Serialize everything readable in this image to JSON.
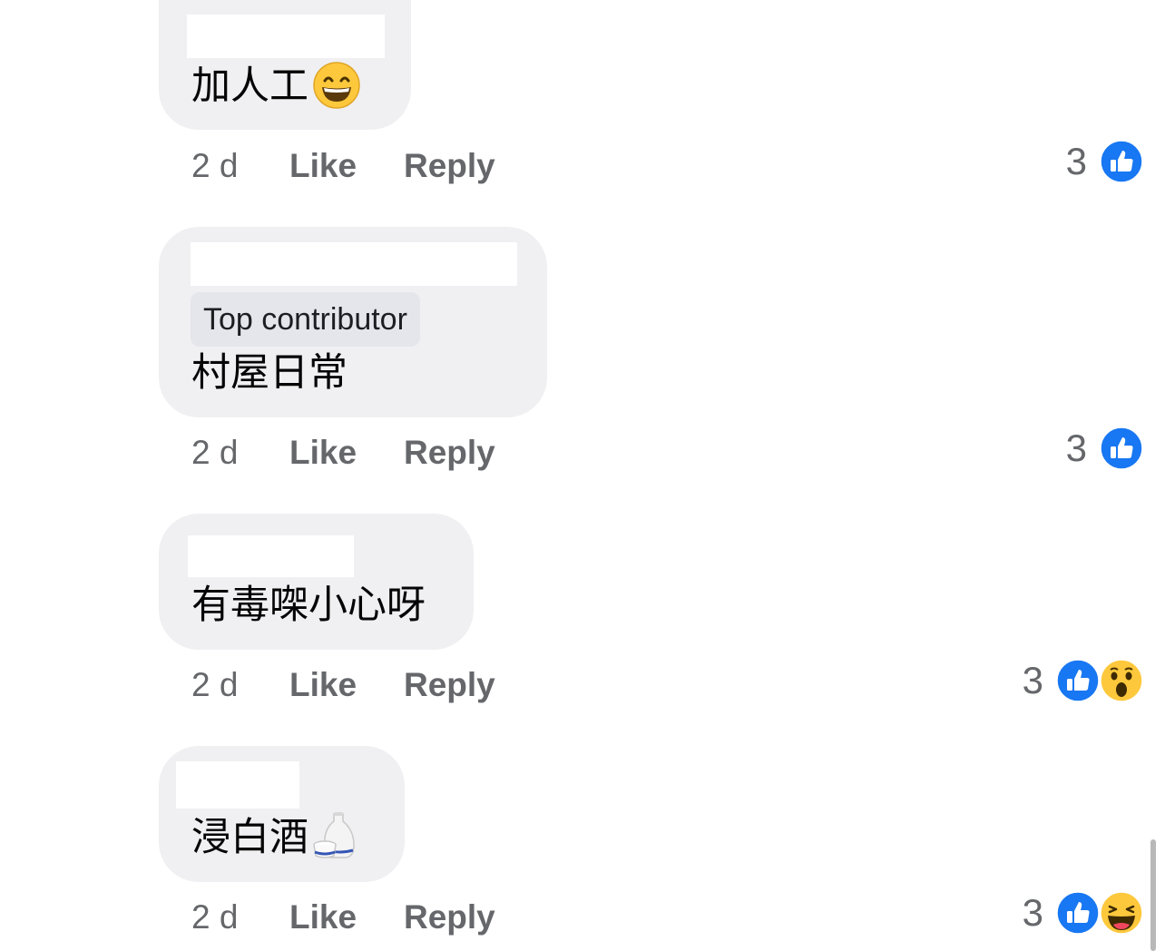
{
  "comments": [
    {
      "text": "加人工",
      "emoji": "grinning-face-icon",
      "badge": "",
      "time": "2 d",
      "like_label": "Like",
      "reply_label": "Reply",
      "reaction_count": "3",
      "reactions": [
        "like-reaction-icon"
      ]
    },
    {
      "text": "村屋日常",
      "emoji": "",
      "badge": "Top contributor",
      "time": "2 d",
      "like_label": "Like",
      "reply_label": "Reply",
      "reaction_count": "3",
      "reactions": [
        "like-reaction-icon"
      ]
    },
    {
      "text": "有毒㗎小心呀",
      "emoji": "",
      "badge": "",
      "time": "2 d",
      "like_label": "Like",
      "reply_label": "Reply",
      "reaction_count": "3",
      "reactions": [
        "like-reaction-icon",
        "wow-reaction-icon"
      ]
    },
    {
      "text": "浸白酒",
      "emoji": "sake-icon",
      "badge": "",
      "time": "2 d",
      "like_label": "Like",
      "reply_label": "Reply",
      "reaction_count": "3",
      "reactions": [
        "like-reaction-icon",
        "haha-reaction-icon"
      ]
    }
  ],
  "colors": {
    "bubble": "#f0f0f3",
    "meta_text": "#65676b",
    "like_blue": "#1877f2",
    "emoji_yellow": "#fdc83c"
  }
}
